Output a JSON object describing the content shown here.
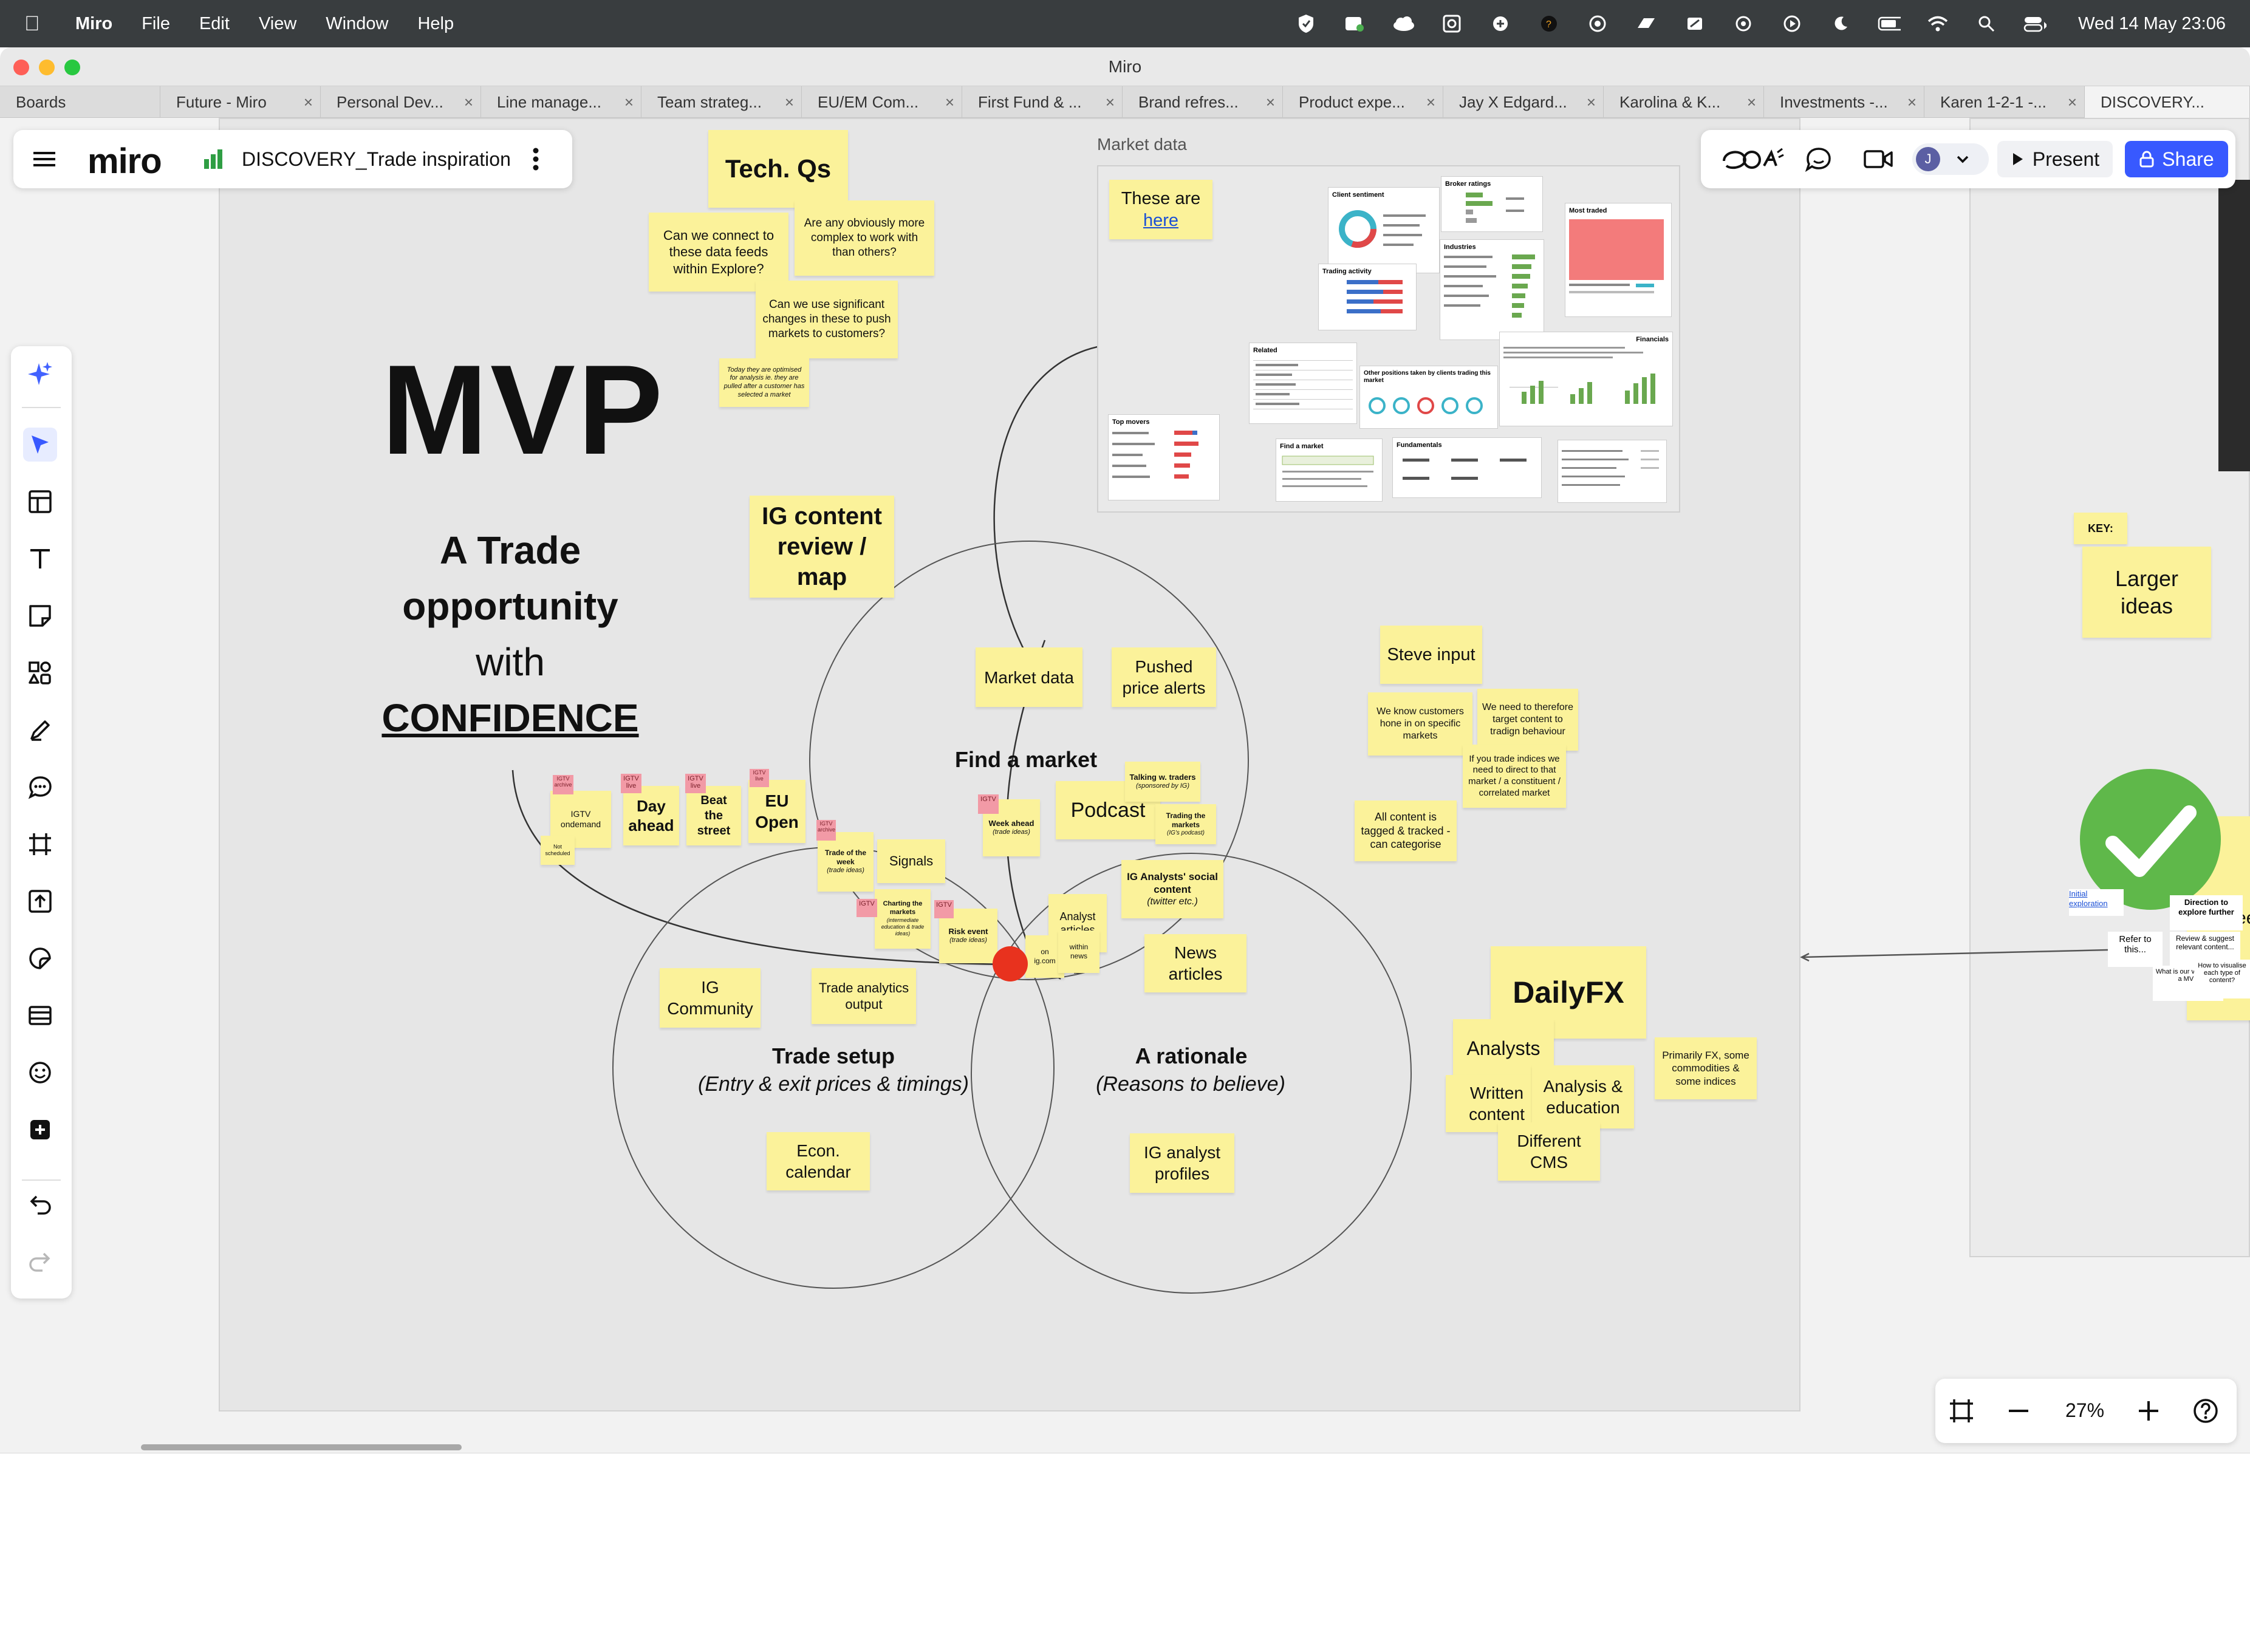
{
  "menubar": {
    "app": "Miro",
    "items": [
      "File",
      "Edit",
      "View",
      "Window",
      "Help"
    ],
    "clock": "Wed 14 May  23:06"
  },
  "window": {
    "title": "Miro"
  },
  "tabs": [
    "Boards",
    "Future - Miro",
    "Personal Dev...",
    "Line manage...",
    "Team strateg...",
    "EU/EM Com...",
    "First Fund & ...",
    "Brand refres...",
    "Product expe...",
    "Jay X Edgard...",
    "Karolina & K...",
    "Investments -...",
    "Karen 1-2-1 -...",
    "DISCOVERY..."
  ],
  "board_header": {
    "logo": "miro",
    "board_name": "DISCOVERY_Trade inspiration"
  },
  "top_right": {
    "avatar_initial": "J",
    "present_label": "Present",
    "share_label": "Share"
  },
  "zoom": {
    "level": "27%"
  },
  "board": {
    "mvp": "MVP",
    "subtitle": {
      "line1": "A Trade",
      "line2": "opportunity",
      "line3": "with",
      "line4": "CONFIDENCE"
    },
    "tech_qs": {
      "title": "Tech. Qs",
      "q1": "Can we connect to these data feeds within Explore?",
      "q2": "Are any obviously more complex to work with than others?",
      "q3": "Can we use significant changes in these to push markets to customers?",
      "q4": "Today they are optimised for analysis ie. they are pulled after a customer has selected a market"
    },
    "market_data": {
      "frame_label": "Market data",
      "these_are": "These are",
      "here_link": "here"
    },
    "ig_content": "IG content review / map",
    "find_market": {
      "title": "Find a market",
      "market_data": "Market data",
      "pushed_alerts": "Pushed price alerts",
      "podcast": "Podcast",
      "talking_traders": "Talking w. traders",
      "talking_traders_sub": "(sponsored by IG)",
      "trading_markets": "Trading the markets",
      "trading_markets_sub": "(IG's podcast)",
      "week_ahead": "Week ahead",
      "week_ahead_sub": "(trade ideas)"
    },
    "trade_setup": {
      "title": "Trade setup",
      "subtitle": "(Entry & exit prices & timings)",
      "ig_community": "IG Community",
      "trade_analytics": "Trade analytics output",
      "econ_calendar": "Econ. calendar",
      "signals": "Signals",
      "trade_of_week": "Trade of the week",
      "trade_of_week_sub": "(trade ideas)",
      "charting": "Charting the markets",
      "charting_sub": "(intermediate education & trade ideas)",
      "risk_event": "Risk event",
      "risk_event_sub": "(trade ideas)"
    },
    "rationale": {
      "title": "A rationale",
      "subtitle": "(Reasons to believe)",
      "news_articles": "News articles",
      "analysts_social": "IG Analysts' social content",
      "analysts_social_sub": "(twitter etc.)",
      "analyst_articles": "Analyst articles",
      "on_ig": "on ig.com",
      "within_news": "within news",
      "ig_analyst_profiles": "IG analyst profiles"
    },
    "igtv": {
      "ondemand": "IGTV ondemand",
      "not_scheduled": "Not scheduled",
      "day_ahead": "Day ahead",
      "beat_street": "Beat the street",
      "eu_open": "EU Open",
      "tag": "IGTV",
      "tag_archive": "IGTV archive",
      "tag_live": "IGTV live"
    },
    "steve": {
      "title": "Steve input",
      "s1": "We know customers hone in on specific markets",
      "s2": "We need to therefore target content to tradign behaviour",
      "s3": "If you trade indices we need to direct to that market / a constituent / correlated market",
      "s4": "All content is tagged & tracked - can categorise"
    },
    "dailyfx": {
      "title": "DailyFX",
      "analysts": "Analysts",
      "written": "Written content",
      "analysis_edu": "Analysis & education",
      "different_cms": "Different CMS",
      "primarily": "Primarily FX, some commodities & some indices"
    },
    "key": {
      "label": "KEY:",
      "larger": "Larger ideas"
    },
    "right_partial": {
      "enter_feed": "ente feed",
      "initial_link": "Initial exploration",
      "direction": "Direction to explore further",
      "refer": "Refer to this...",
      "review": "Review & suggest relevant content...",
      "what_is": "What is our version of a MVP",
      "how_to": "How to visualise each type of content?"
    },
    "market_cards": {
      "client_sentiment": "Client sentiment",
      "broker_ratings": "Broker ratings",
      "most_traded": "Most traded",
      "trading_activity": "Trading activity",
      "industries": "Industries",
      "related": "Related",
      "other_positions": "Other positions taken by clients trading this market",
      "top_movers": "Top movers",
      "find_market": "Find a market",
      "fundamentals": "Fundamentals",
      "financials": "Financials"
    }
  }
}
